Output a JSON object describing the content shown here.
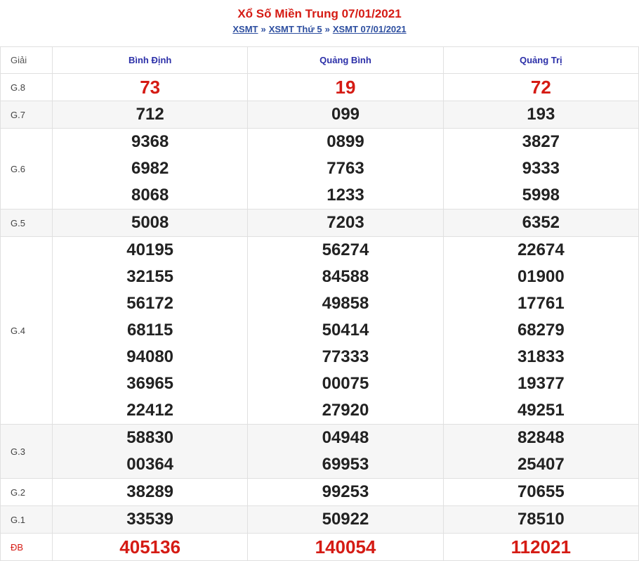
{
  "header": {
    "title": "Xổ Số Miền Trung 07/01/2021",
    "breadcrumb": [
      "XSMT",
      "XSMT Thứ 5",
      "XSMT 07/01/2021"
    ],
    "separator": "»"
  },
  "table": {
    "columns": [
      "Giải",
      "Bình Định",
      "Quảng Bình",
      "Quảng Trị"
    ],
    "rows": [
      {
        "label": "G.8",
        "values": [
          [
            "73"
          ],
          [
            "19"
          ],
          [
            "72"
          ]
        ]
      },
      {
        "label": "G.7",
        "values": [
          [
            "712"
          ],
          [
            "099"
          ],
          [
            "193"
          ]
        ]
      },
      {
        "label": "G.6",
        "values": [
          [
            "9368",
            "6982",
            "8068"
          ],
          [
            "0899",
            "7763",
            "1233"
          ],
          [
            "3827",
            "9333",
            "5998"
          ]
        ]
      },
      {
        "label": "G.5",
        "values": [
          [
            "5008"
          ],
          [
            "7203"
          ],
          [
            "6352"
          ]
        ]
      },
      {
        "label": "G.4",
        "values": [
          [
            "40195",
            "32155",
            "56172",
            "68115",
            "94080",
            "36965",
            "22412"
          ],
          [
            "56274",
            "84588",
            "49858",
            "50414",
            "77333",
            "00075",
            "27920"
          ],
          [
            "22674",
            "01900",
            "17761",
            "68279",
            "31833",
            "19377",
            "49251"
          ]
        ]
      },
      {
        "label": "G.3",
        "values": [
          [
            "58830",
            "00364"
          ],
          [
            "04948",
            "69953"
          ],
          [
            "82848",
            "25407"
          ]
        ]
      },
      {
        "label": "G.2",
        "values": [
          [
            "38289"
          ],
          [
            "99253"
          ],
          [
            "70655"
          ]
        ]
      },
      {
        "label": "G.1",
        "values": [
          [
            "33539"
          ],
          [
            "50922"
          ],
          [
            "78510"
          ]
        ]
      },
      {
        "label": "ĐB",
        "values": [
          [
            "405136"
          ],
          [
            "140054"
          ],
          [
            "112021"
          ]
        ]
      }
    ]
  },
  "colors": {
    "accent_red": "#d51b14",
    "header_blue": "#2b2fa8",
    "link_blue": "#2e4fa0"
  }
}
